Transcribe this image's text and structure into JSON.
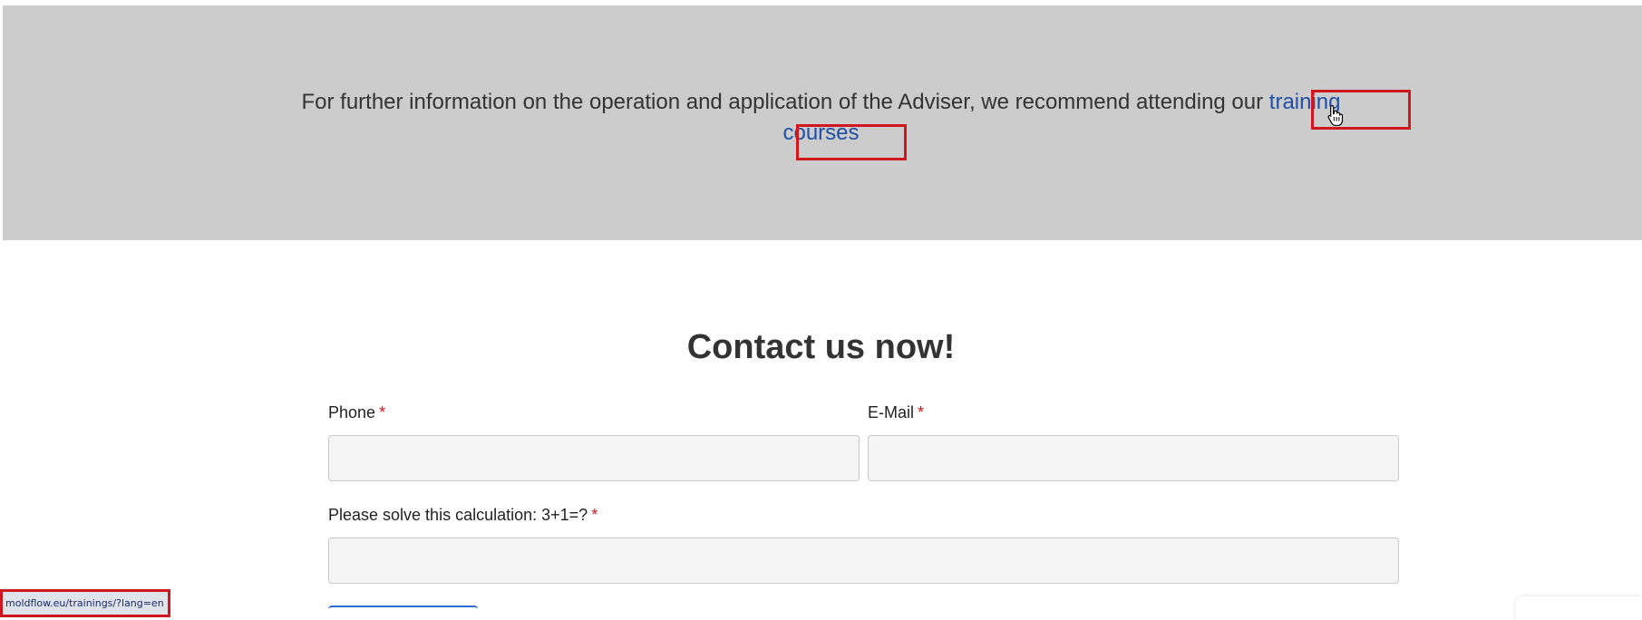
{
  "banner": {
    "text_before_link": "For further information on the operation and application of the Adviser, we recommend attending our ",
    "link_part1": "training",
    "link_part2": "courses"
  },
  "contact": {
    "title": "Contact us now!",
    "phone_label": "Phone",
    "email_label": "E-Mail",
    "calc_label": "Please solve this calculation: 3+1=?",
    "required_marker": "*",
    "phone_value": "",
    "email_value": "",
    "calc_value": ""
  },
  "status_bar": {
    "url": "moldflow.eu/trainings/?lang=en"
  },
  "colors": {
    "banner_bg": "#cccccc",
    "link": "#1f4fa8",
    "highlight": "#d0161e",
    "required": "#d0161e"
  },
  "icons": {
    "cursor": "hand-pointer-icon"
  }
}
